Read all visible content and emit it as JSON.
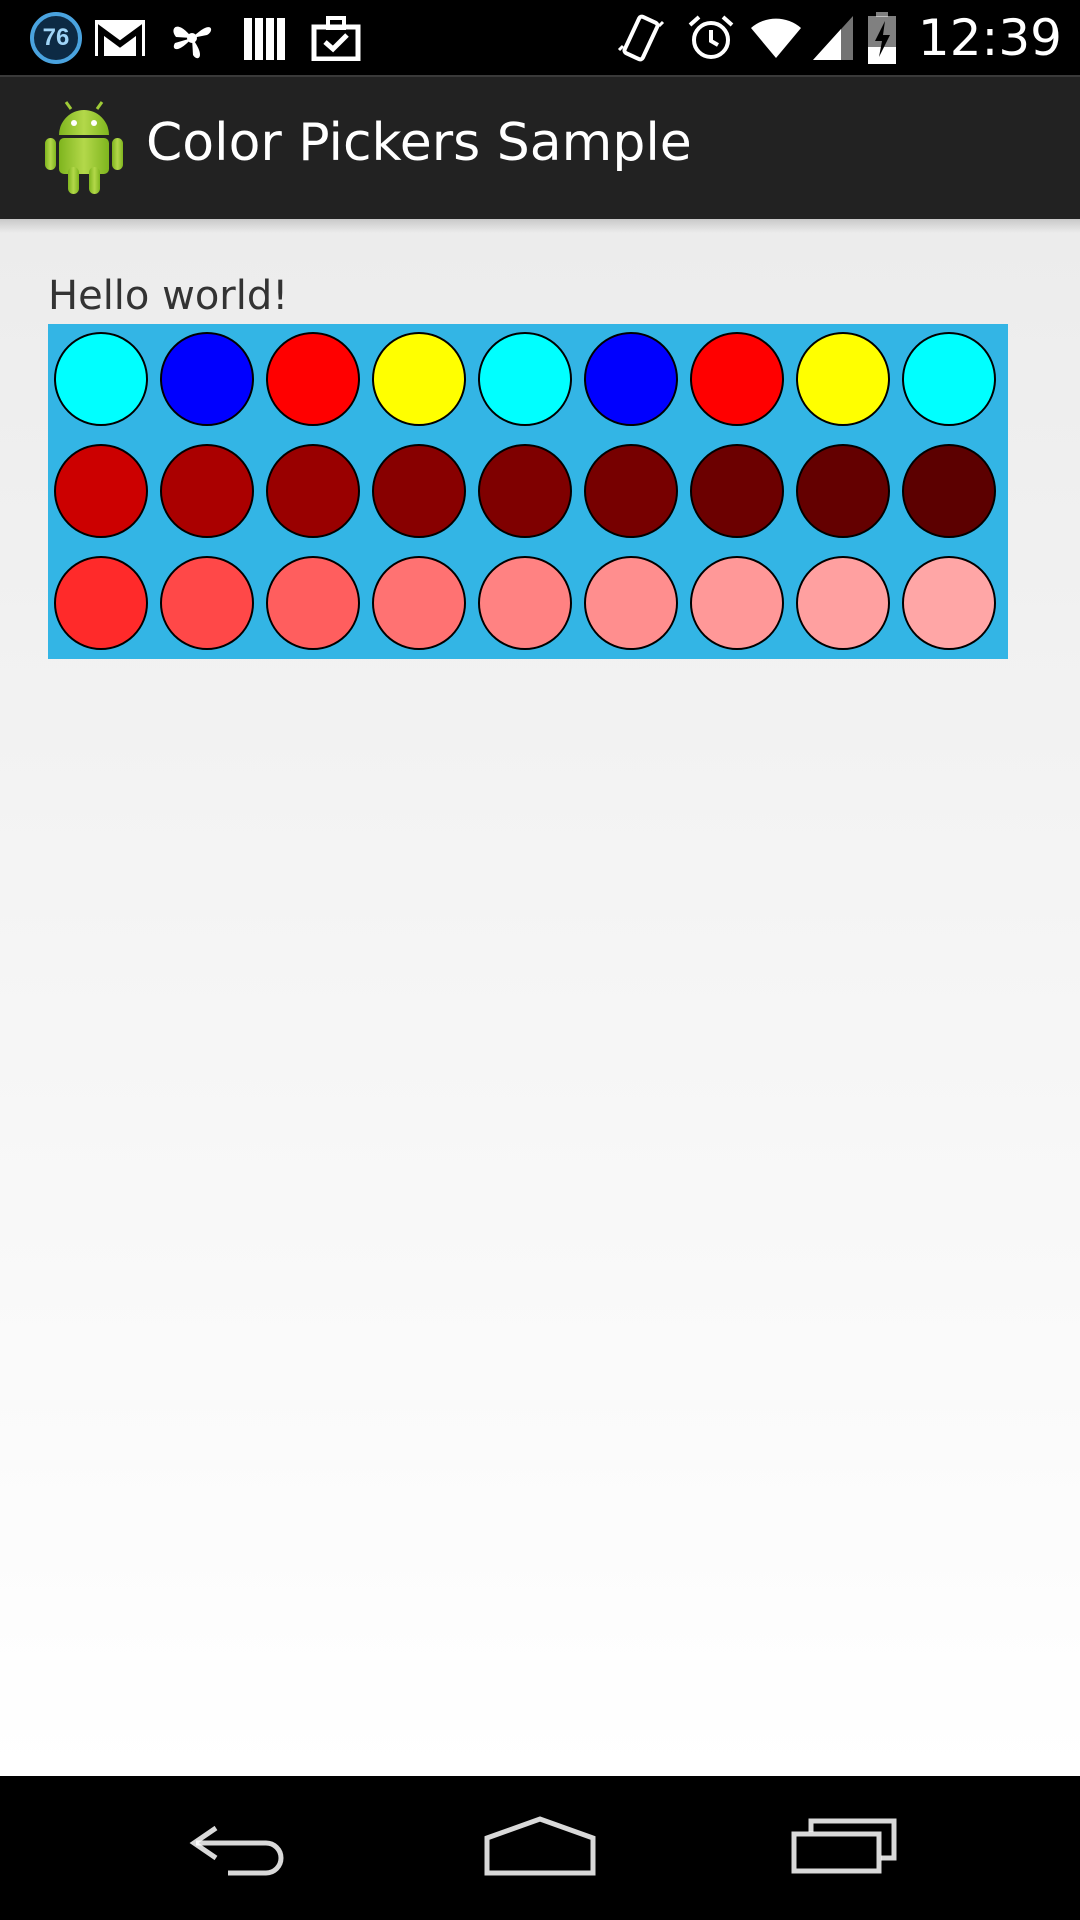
{
  "status_bar": {
    "notification_badge": "76",
    "clock": "12:39",
    "left_icons": [
      "badge-76-icon",
      "gmail-icon",
      "pinwheel-icon",
      "books-icon",
      "briefcase-check-icon"
    ],
    "right_icons": [
      "vibrate-icon",
      "alarm-icon",
      "wifi-icon",
      "signal-icon",
      "battery-charging-icon"
    ]
  },
  "action_bar": {
    "title": "Color Pickers Sample",
    "icon": "android-robot-icon"
  },
  "content": {
    "greeting": "Hello world!",
    "picker_background": "#33b5e5",
    "swatch_rows": [
      [
        "#00ffff",
        "#0000ff",
        "#ff0000",
        "#ffff00",
        "#00ffff",
        "#0000ff",
        "#ff0000",
        "#ffff00",
        "#00ffff"
      ],
      [
        "#cc0000",
        "#aa0000",
        "#990000",
        "#880000",
        "#7f0000",
        "#770000",
        "#6c0000",
        "#640000",
        "#5c0000"
      ],
      [
        "#ff2a2a",
        "#ff4848",
        "#ff5e5e",
        "#ff7272",
        "#ff8282",
        "#ff8e8e",
        "#ff9898",
        "#ffa0a0",
        "#ffa6a6"
      ]
    ]
  },
  "nav_bar": {
    "buttons": [
      "back-icon",
      "home-icon",
      "recents-icon"
    ]
  }
}
